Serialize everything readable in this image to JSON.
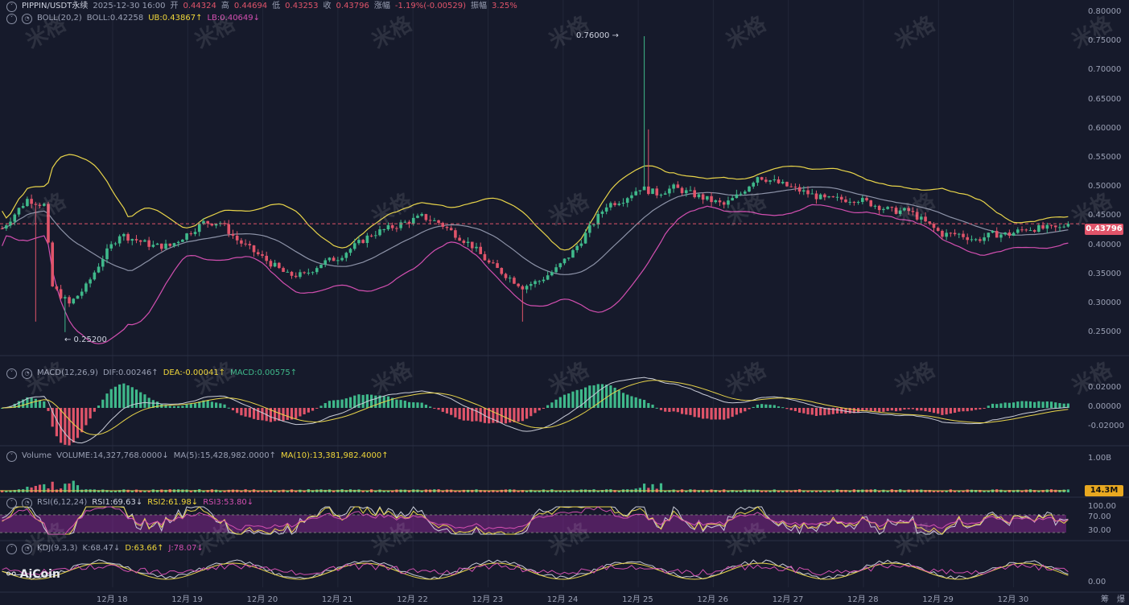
{
  "header": {
    "symbol": "PIPPIN/USDT永续",
    "datetime": "2025-12-30 16:00",
    "open_label": "开",
    "open": "0.44324",
    "high_label": "高",
    "high": "0.44694",
    "low_label": "低",
    "low": "0.43253",
    "close_label": "收",
    "close": "0.43796",
    "change_label": "涨幅",
    "change": "-1.19%(-0.00529)",
    "amp_label": "振幅",
    "amp": "3.25%"
  },
  "boll": {
    "name": "BOLL(20,2)",
    "value": "BOLL:0.42258",
    "ub": "UB:0.43867↑",
    "lb": "LB:0.40649↓"
  },
  "macd": {
    "name": "MACD(12,26,9)",
    "dif": "DIF:0.00246↑",
    "dea": "DEA:-0.00041↑",
    "macd": "MACD:0.00575↑"
  },
  "volume": {
    "name": "Volume",
    "vol": "VOLUME:14,327,768.0000↓",
    "ma5": "MA(5):15,428,982.0000↑",
    "ma10": "MA(10):13,381,982.4000↑",
    "tag": "14.3M"
  },
  "rsi": {
    "name": "RSI(6,12,24)",
    "r1": "RSI1:69.63↓",
    "r2": "RSI2:61.98↓",
    "r3": "RSI3:53.80↓"
  },
  "kdj": {
    "name": "KDJ(9,3,3)",
    "k": "K:68.47↓",
    "d": "D:63.66↑",
    "j": "J:78.07↓"
  },
  "annotations": {
    "high_mark": "0.76000 →",
    "low_mark": "← 0.25200"
  },
  "price_tag": "0.43796",
  "logo": "AiCoin",
  "watermark": "米格",
  "corner": {
    "a": "筹",
    "b": "爆"
  },
  "colors": {
    "up": "#3fb98b",
    "down": "#e0546a",
    "boll_mid": "#8d93a8",
    "boll_ub": "#e8d44a",
    "boll_lb": "#d24fb0",
    "bg": "#161a2b"
  },
  "chart_data": {
    "type": "candlestick",
    "price_axis": {
      "ticks": [
        "0.80000",
        "0.75000",
        "0.70000",
        "0.65000",
        "0.60000",
        "0.55000",
        "0.50000",
        "0.45000",
        "0.40000",
        "0.35000",
        "0.30000",
        "0.25000"
      ],
      "ylim": [
        0.22,
        0.8
      ]
    },
    "macd_axis": {
      "ticks": [
        "0.02000",
        "0.00000",
        "-0.02000"
      ]
    },
    "volume_axis": {
      "ticks": [
        "1.00B"
      ]
    },
    "rsi_axis": {
      "ticks": [
        "100.00",
        "70.00",
        "30.00"
      ]
    },
    "kdj_axis": {
      "ticks": [
        "0.00"
      ]
    },
    "x_ticks": [
      "12月 18",
      "12月 19",
      "12月 20",
      "12月 21",
      "12月 22",
      "12月 23",
      "12月 24",
      "12月 25",
      "12月 26",
      "12月 27",
      "12月 28",
      "12月 29",
      "12月 30"
    ],
    "price_keypoints": [
      [
        0,
        0.43
      ],
      [
        6,
        0.48
      ],
      [
        10,
        0.47
      ],
      [
        12,
        0.33
      ],
      [
        16,
        0.3
      ],
      [
        20,
        0.33
      ],
      [
        24,
        0.38
      ],
      [
        28,
        0.42
      ],
      [
        32,
        0.41
      ],
      [
        36,
        0.4
      ],
      [
        40,
        0.4
      ],
      [
        44,
        0.42
      ],
      [
        48,
        0.44
      ],
      [
        52,
        0.44
      ],
      [
        56,
        0.41
      ],
      [
        60,
        0.39
      ],
      [
        64,
        0.37
      ],
      [
        68,
        0.35
      ],
      [
        72,
        0.35
      ],
      [
        76,
        0.37
      ],
      [
        80,
        0.38
      ],
      [
        84,
        0.4
      ],
      [
        88,
        0.42
      ],
      [
        92,
        0.43
      ],
      [
        96,
        0.44
      ],
      [
        100,
        0.45
      ],
      [
        104,
        0.44
      ],
      [
        108,
        0.42
      ],
      [
        112,
        0.4
      ],
      [
        116,
        0.37
      ],
      [
        120,
        0.35
      ],
      [
        124,
        0.33
      ],
      [
        128,
        0.34
      ],
      [
        132,
        0.36
      ],
      [
        136,
        0.39
      ],
      [
        140,
        0.43
      ],
      [
        144,
        0.47
      ],
      [
        148,
        0.48
      ],
      [
        152,
        0.5
      ],
      [
        156,
        0.49
      ],
      [
        160,
        0.5
      ],
      [
        164,
        0.49
      ],
      [
        168,
        0.48
      ],
      [
        172,
        0.47
      ],
      [
        176,
        0.49
      ],
      [
        180,
        0.52
      ],
      [
        184,
        0.51
      ],
      [
        188,
        0.5
      ],
      [
        192,
        0.49
      ],
      [
        196,
        0.48
      ],
      [
        200,
        0.48
      ],
      [
        204,
        0.48
      ],
      [
        208,
        0.47
      ],
      [
        212,
        0.46
      ],
      [
        216,
        0.46
      ],
      [
        220,
        0.44
      ],
      [
        224,
        0.42
      ],
      [
        228,
        0.42
      ],
      [
        232,
        0.41
      ],
      [
        236,
        0.42
      ],
      [
        240,
        0.42
      ],
      [
        244,
        0.43
      ],
      [
        248,
        0.43
      ],
      [
        252,
        0.43
      ],
      [
        254,
        0.44
      ]
    ],
    "spikes": {
      "high": {
        "value": 0.76
      },
      "low": {
        "value": 0.252
      }
    },
    "current_price": 0.43796
  }
}
